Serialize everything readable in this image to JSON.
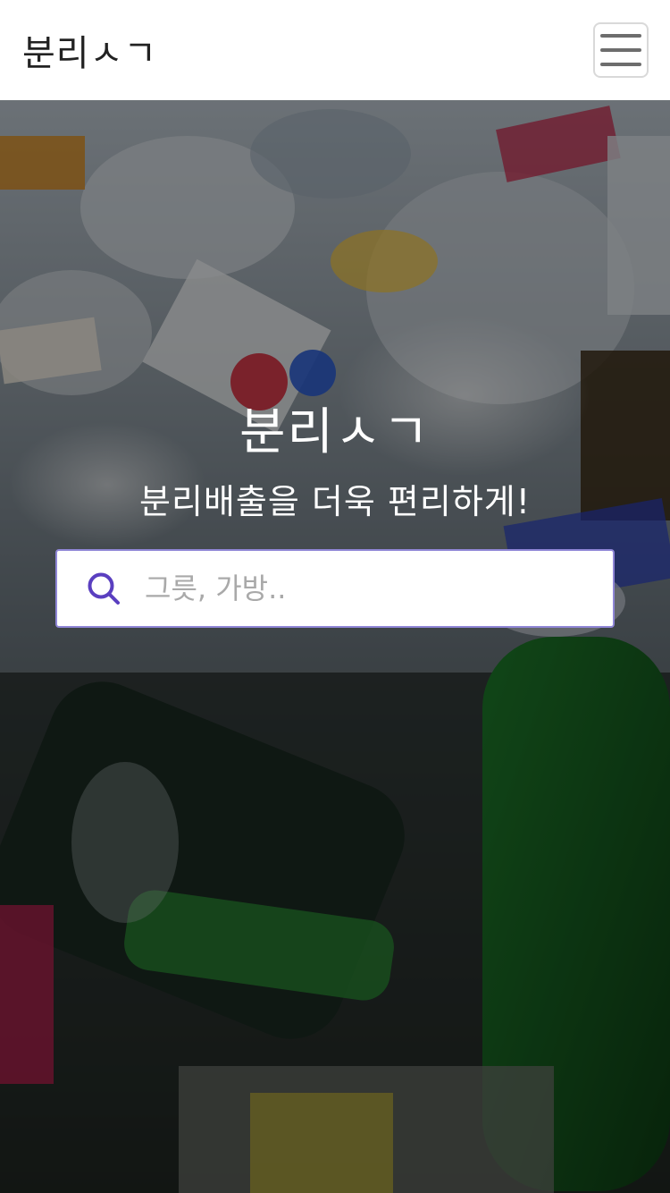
{
  "navbar": {
    "brand": "분리ㅅㄱ",
    "menu_icon": "hamburger-menu-icon"
  },
  "hero": {
    "title": "분리ㅅㄱ",
    "subtitle": "분리배출을 더욱 편리하게!",
    "search": {
      "placeholder": "그릇, 가방..",
      "value": "",
      "icon": "search-icon"
    }
  },
  "colors": {
    "accent": "#5a3fc0",
    "navbar_bg": "#ffffff",
    "overlay": "rgba(0,0,0,0.42)"
  }
}
